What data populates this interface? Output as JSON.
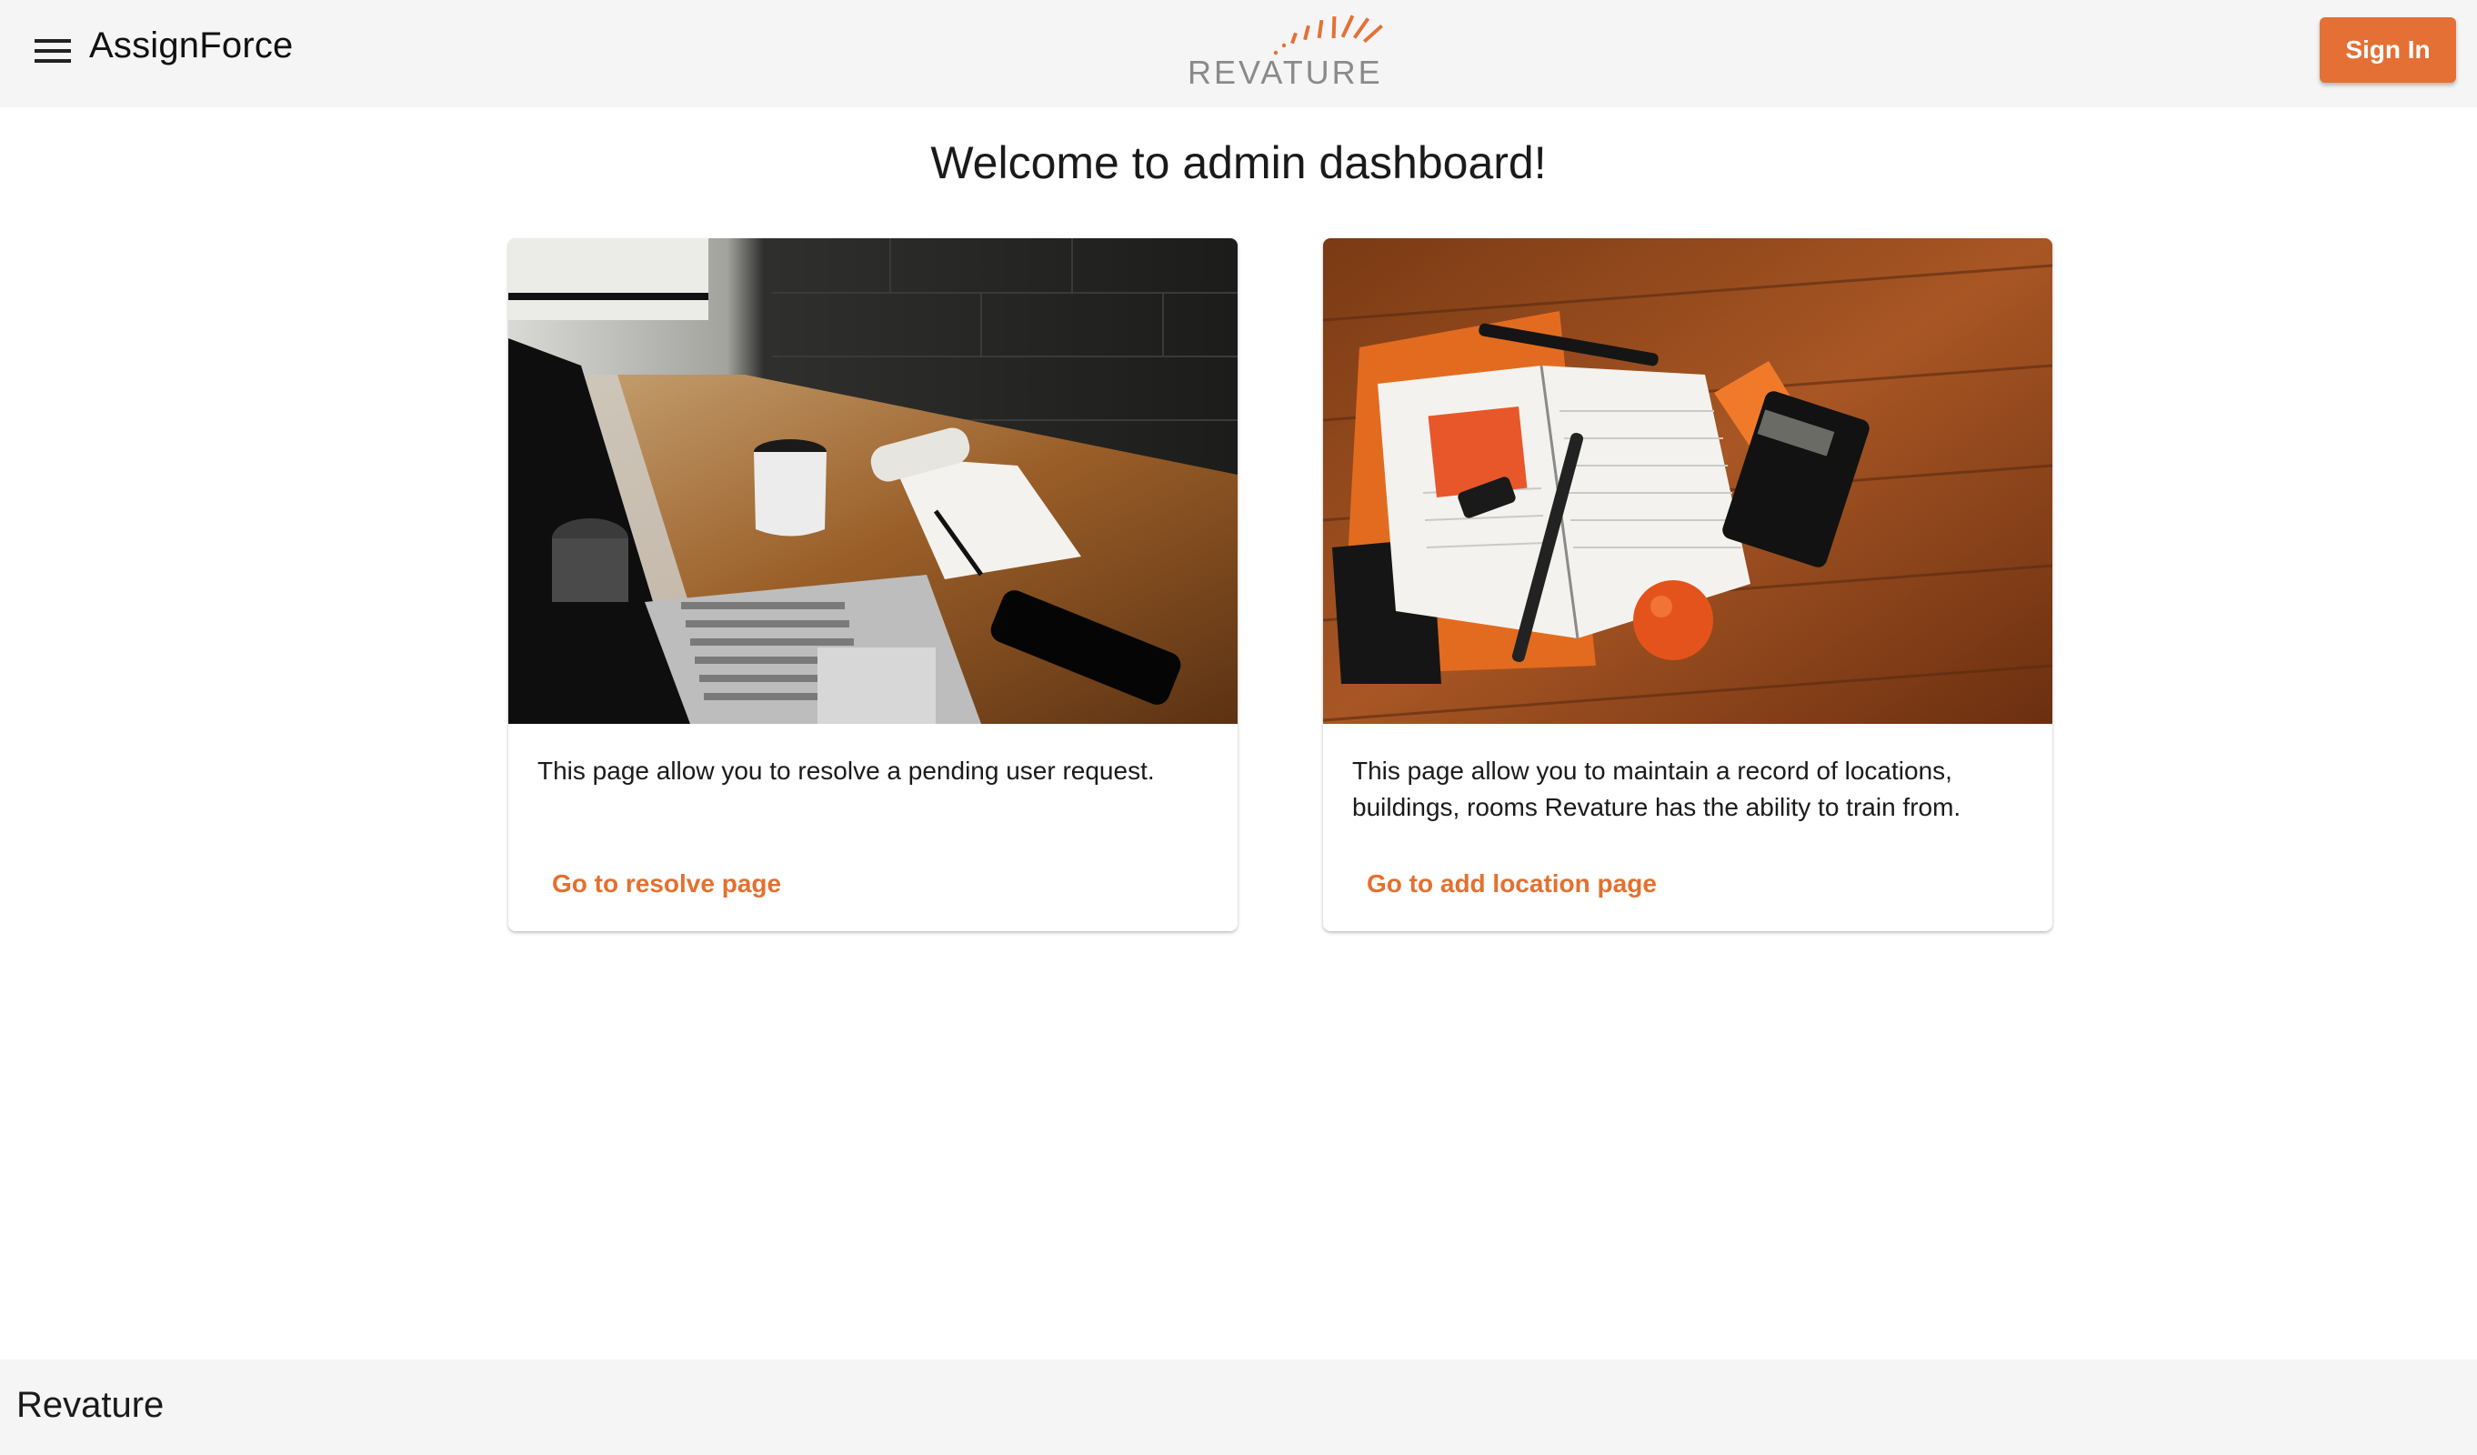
{
  "header": {
    "menu_icon": "hamburger-menu-icon",
    "app_title": "AssignForce",
    "logo_text": "REVATURE",
    "signin_label": "Sign In"
  },
  "main": {
    "title": "Welcome to admin dashboard!",
    "cards": [
      {
        "image": "laptop-coffee-desk-photo",
        "description": "This page allow you to resolve a pending user request.",
        "link_label": "Go to resolve page"
      },
      {
        "image": "planner-calculator-desk-photo",
        "description": "This page allow you to maintain a record of locations, buildings, rooms Revature has the ability to train from.",
        "link_label": "Go to add location page"
      }
    ]
  },
  "footer": {
    "text": "Revature"
  },
  "colors": {
    "accent": "#e47036",
    "toolbar_bg": "#f5f5f5",
    "logo_gray": "#8a8a8a"
  }
}
